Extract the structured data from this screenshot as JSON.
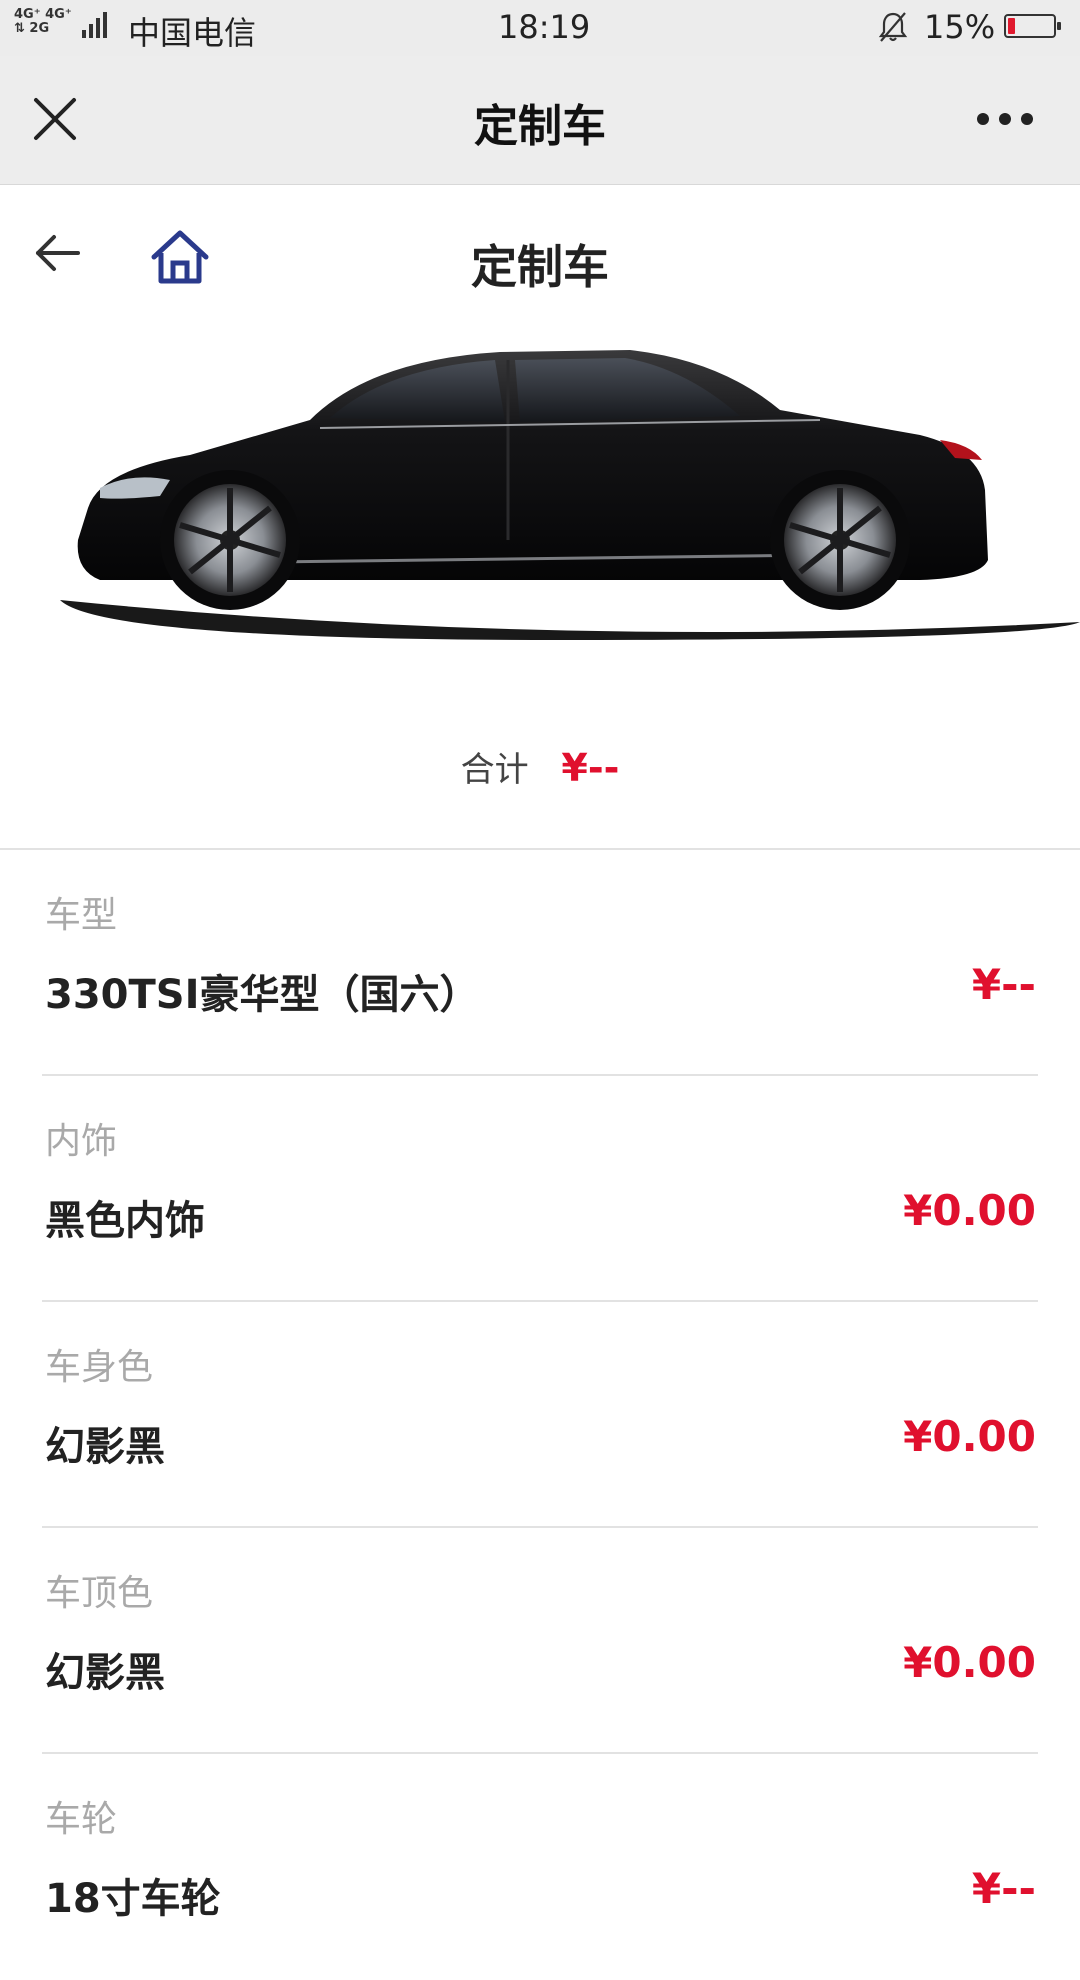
{
  "status_bar": {
    "signal_text": "4G⁺ 4G⁺\n⇅ 2G",
    "carrier": "中国电信",
    "time": "18:19",
    "battery_percent": "15%",
    "battery_level": 0.15,
    "battery_color": "#e0192e"
  },
  "wechat_header": {
    "title": "定制车",
    "close_icon": "close-icon",
    "more_icon": "more-icon"
  },
  "page_header": {
    "title": "定制车",
    "back_icon": "arrow-left-icon",
    "home_icon": "home-icon",
    "home_icon_color": "#2a3a8c"
  },
  "car_image": {
    "icon": "car-image"
  },
  "total": {
    "label": "合计",
    "value": "¥--"
  },
  "options": [
    {
      "label": "车型",
      "name": "330TSI豪华型（国六）",
      "price": "¥--"
    },
    {
      "label": "内饰",
      "name": "黑色内饰",
      "price": "¥0.00"
    },
    {
      "label": "车身色",
      "name": "幻影黑",
      "price": "¥0.00"
    },
    {
      "label": "车顶色",
      "name": "幻影黑",
      "price": "¥0.00"
    },
    {
      "label": "车轮",
      "name": "18寸车轮",
      "price": "¥--"
    }
  ],
  "colors": {
    "accent_price": "#e0102e",
    "header_bg": "#ededed",
    "label_gray": "#a9a9a9"
  }
}
